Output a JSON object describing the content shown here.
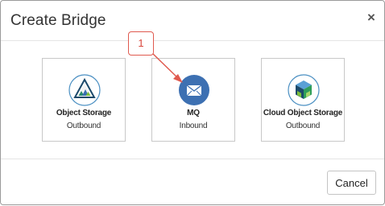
{
  "dialog": {
    "title": "Create Bridge",
    "close_glyph": "×"
  },
  "cards": [
    {
      "name": "Object Storage",
      "direction": "Outbound",
      "icon": "object-storage-icon"
    },
    {
      "name": "MQ",
      "direction": "Inbound",
      "icon": "mq-envelope-icon"
    },
    {
      "name": "Cloud Object Storage",
      "direction": "Outbound",
      "icon": "cloud-object-storage-icon"
    }
  ],
  "callout": {
    "label": "1"
  },
  "footer": {
    "cancel_label": "Cancel"
  },
  "colors": {
    "mq_blue": "#3d70b2",
    "callout_red": "#e05a4f",
    "cos_green": "#2f9e5a"
  }
}
